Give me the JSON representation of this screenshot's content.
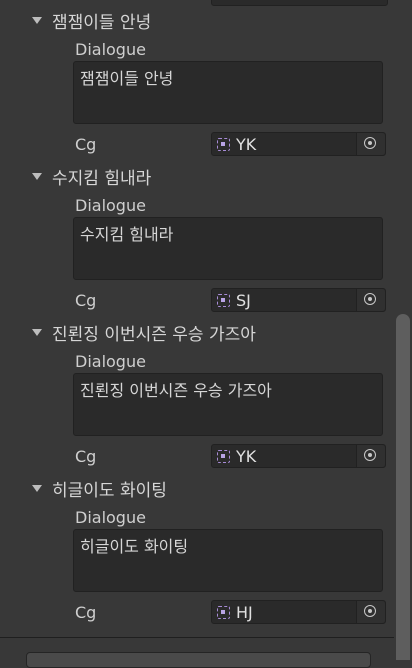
{
  "elements": [
    {
      "title": "잼잼이들 안녕",
      "dialogue_label": "Dialogue",
      "dialogue": "잼잼이들 안녕",
      "cg_label": "Cg",
      "cg_value": "YK",
      "cg_icon": "sprite-icon",
      "picker_icon": "object-picker-icon"
    },
    {
      "title": "수지킴 힘내라",
      "dialogue_label": "Dialogue",
      "dialogue": "수지킴 힘내라",
      "cg_label": "Cg",
      "cg_value": "SJ",
      "cg_icon": "sprite-icon",
      "picker_icon": "object-picker-icon"
    },
    {
      "title": "진뢴징 이번시즌 우승 가즈아",
      "dialogue_label": "Dialogue",
      "dialogue": "진뢴징 이번시즌 우승 가즈아",
      "cg_label": "Cg",
      "cg_value": "YK",
      "cg_icon": "sprite-icon",
      "picker_icon": "object-picker-icon"
    },
    {
      "title": "히글이도 화이팅",
      "dialogue_label": "Dialogue",
      "dialogue": "히글이도 화이팅",
      "cg_label": "Cg",
      "cg_value": "HJ",
      "cg_icon": "sprite-icon",
      "picker_icon": "object-picker-icon"
    }
  ],
  "colors": {
    "background": "#383838",
    "field": "#2a2a2a",
    "sprite_icon": "#a78bd6"
  }
}
